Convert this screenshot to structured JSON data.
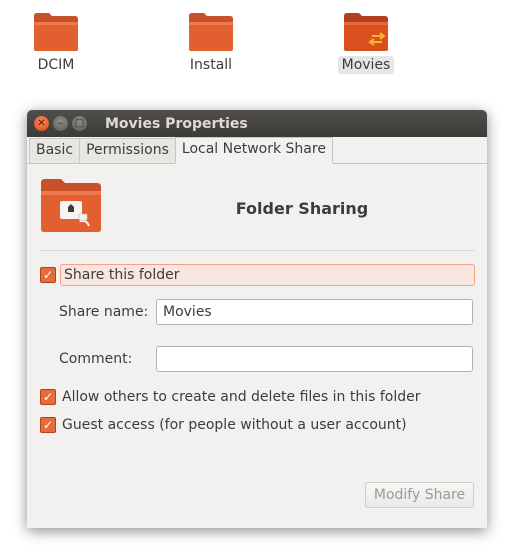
{
  "desktop": {
    "icons": [
      {
        "label": "DCIM"
      },
      {
        "label": "Install"
      },
      {
        "label": "Movies"
      }
    ]
  },
  "window": {
    "title": "Movies Properties",
    "tabs": [
      {
        "label": "Basic"
      },
      {
        "label": "Permissions"
      },
      {
        "label": "Local Network Share"
      }
    ],
    "heading": "Folder Sharing",
    "share_checkbox": {
      "label": "Share this folder",
      "checked": true
    },
    "share_name": {
      "label": "Share name:",
      "value": "Movies"
    },
    "comment": {
      "label": "Comment:",
      "value": ""
    },
    "allow_others": {
      "label": "Allow others to create and delete files in this folder",
      "checked": true
    },
    "guest_access": {
      "label": "Guest access (for people without a user account)",
      "checked": true
    },
    "modify_button": "Modify Share"
  },
  "colors": {
    "folder_orange": "#e2602f",
    "accent": "#e56d3c",
    "titlebar": "#3c3b37"
  },
  "icons": [
    "folder-icon",
    "shared-folder-icon",
    "close-icon",
    "minimize-icon",
    "maximize-icon",
    "check-icon"
  ]
}
